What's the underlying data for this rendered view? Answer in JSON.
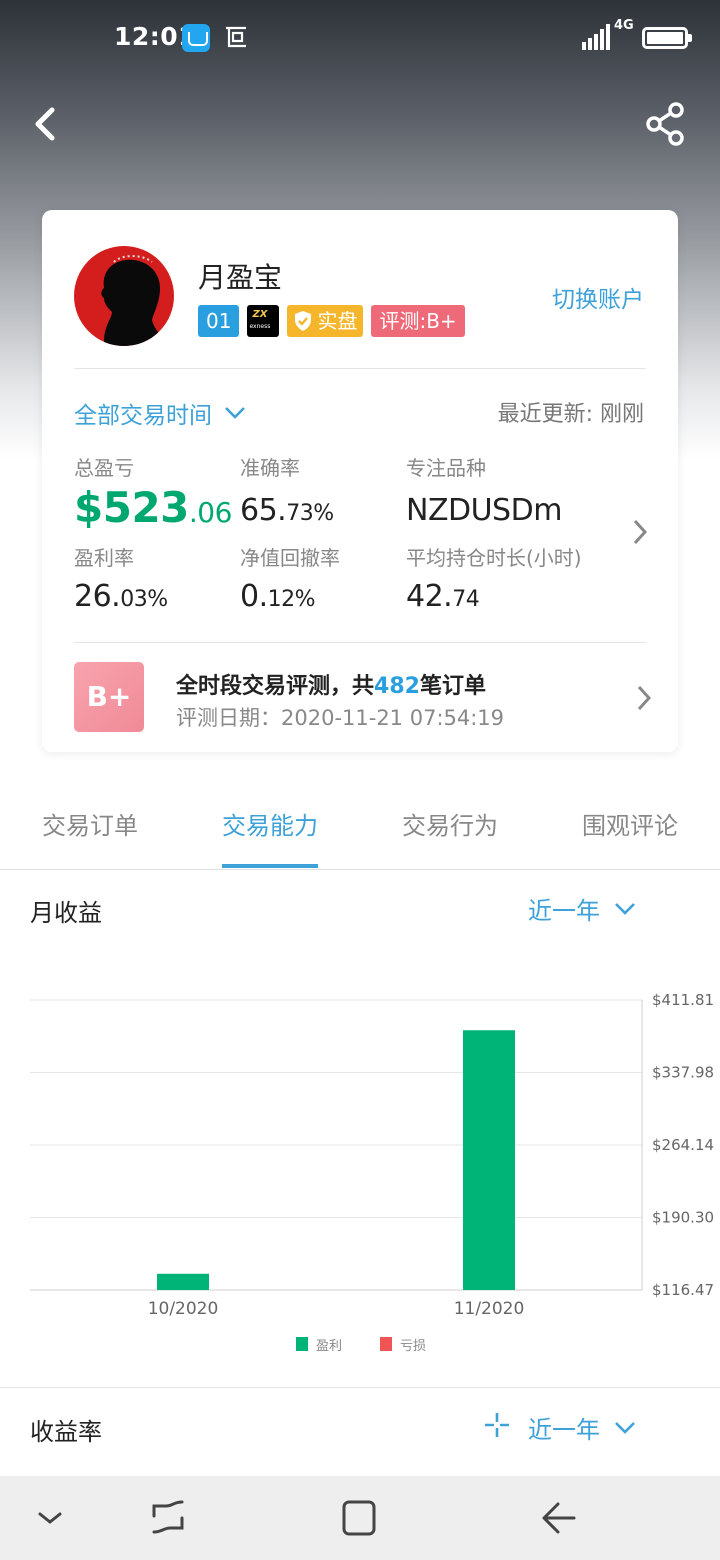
{
  "status_bar": {
    "time": "12:01",
    "network": "4G",
    "icons": [
      "app-store-icon",
      "screenshot-icon",
      "signal-icon",
      "battery-icon"
    ]
  },
  "header": {
    "icons": [
      "back-arrow-icon",
      "share-icon"
    ]
  },
  "profile": {
    "name": "月盈宝",
    "badges": {
      "account_no": "01",
      "broker_logo": "ZX",
      "broker_name": "exness",
      "real_label": "实盘",
      "grade_label": "评测:B+"
    },
    "switch_account": "切换账户",
    "time_range": "全部交易时间",
    "last_update_label": "最近更新:",
    "last_update_value": "刚刚"
  },
  "stats": {
    "total_pnl_label": "总盈亏",
    "total_pnl_currency": "$",
    "total_pnl_int": "523",
    "total_pnl_dec": ".06",
    "accuracy_label": "准确率",
    "accuracy_int": "65.",
    "accuracy_dec": "73%",
    "focus_label": "专注品种",
    "focus_value": "NZDUSDm",
    "return_label": "盈利率",
    "return_int": "26.",
    "return_dec": "03%",
    "drawdown_label": "净值回撤率",
    "drawdown_int": "0.",
    "drawdown_dec": "12%",
    "hold_label": "平均持仓时长(小时)",
    "hold_int": "42.",
    "hold_dec": "74"
  },
  "evaluation": {
    "grade": "B+",
    "title_prefix": "全时段交易评测，共",
    "order_count": "482",
    "title_suffix": "笔订单",
    "date_label": "评测日期：",
    "date_value": "2020-11-21 07:54:19"
  },
  "tabs": [
    {
      "label": "交易订单",
      "active": false
    },
    {
      "label": "交易能力",
      "active": true
    },
    {
      "label": "交易行为",
      "active": false
    },
    {
      "label": "围观评论",
      "active": false
    }
  ],
  "monthly": {
    "title": "月收益",
    "period": "近一年"
  },
  "return_section": {
    "title": "收益率",
    "period": "近一年"
  },
  "colors": {
    "accent": "#3ea1d8",
    "profit": "#00b377",
    "loss": "#f05454"
  },
  "chart_data": {
    "type": "bar",
    "categories": [
      "10/2020",
      "11/2020"
    ],
    "series": [
      {
        "name": "盈利",
        "color": "#00b377",
        "values": [
          133,
          381
        ]
      },
      {
        "name": "亏损",
        "color": "#f05454",
        "values": [
          0,
          0
        ]
      }
    ],
    "ylim": [
      116.47,
      411.81
    ],
    "y_ticks": [
      "$411.81",
      "$337.98",
      "$264.14",
      "$190.30",
      "$116.47"
    ],
    "y_axis_side": "right",
    "grid": true,
    "legend_placement": "bottom-center"
  }
}
